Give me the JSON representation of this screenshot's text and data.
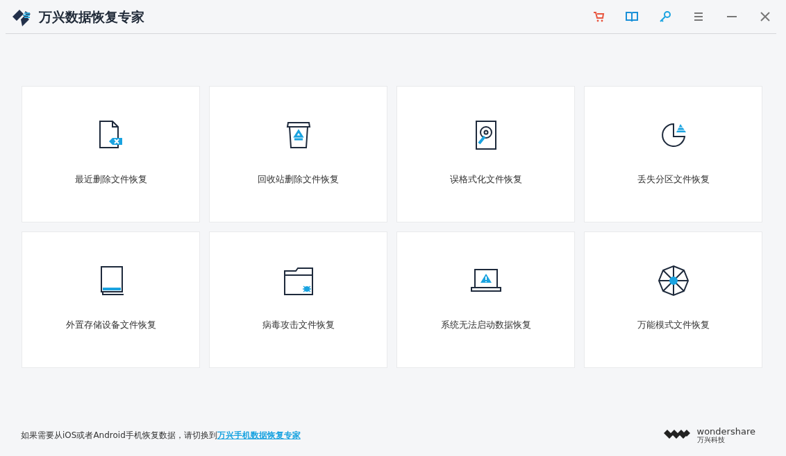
{
  "window": {
    "title": "万兴数据恢复专家"
  },
  "toolbar": [
    {
      "kind": "cart"
    },
    {
      "kind": "book"
    },
    {
      "kind": "key"
    },
    {
      "kind": "menu"
    },
    {
      "kind": "minimize"
    },
    {
      "kind": "close"
    }
  ],
  "cards": [
    {
      "kind": "deleted",
      "label": "最近删除文件恢复"
    },
    {
      "kind": "recycle",
      "label": "回收站删除文件恢复"
    },
    {
      "kind": "format",
      "label": "误格式化文件恢复"
    },
    {
      "kind": "partition",
      "label": "丢失分区文件恢复"
    },
    {
      "kind": "external",
      "label": "外置存储设备文件恢复"
    },
    {
      "kind": "virus",
      "label": "病毒攻击文件恢复"
    },
    {
      "kind": "crash",
      "label": "系统无法启动数据恢复"
    },
    {
      "kind": "all",
      "label": "万能模式文件恢复"
    }
  ],
  "footer": {
    "text": "如果需要从iOS或者Android手机恢复数据，请切换到",
    "link": "万兴手机数据恢复专家"
  },
  "brand": {
    "name": "wondershare",
    "subtitle": "万兴科技"
  }
}
